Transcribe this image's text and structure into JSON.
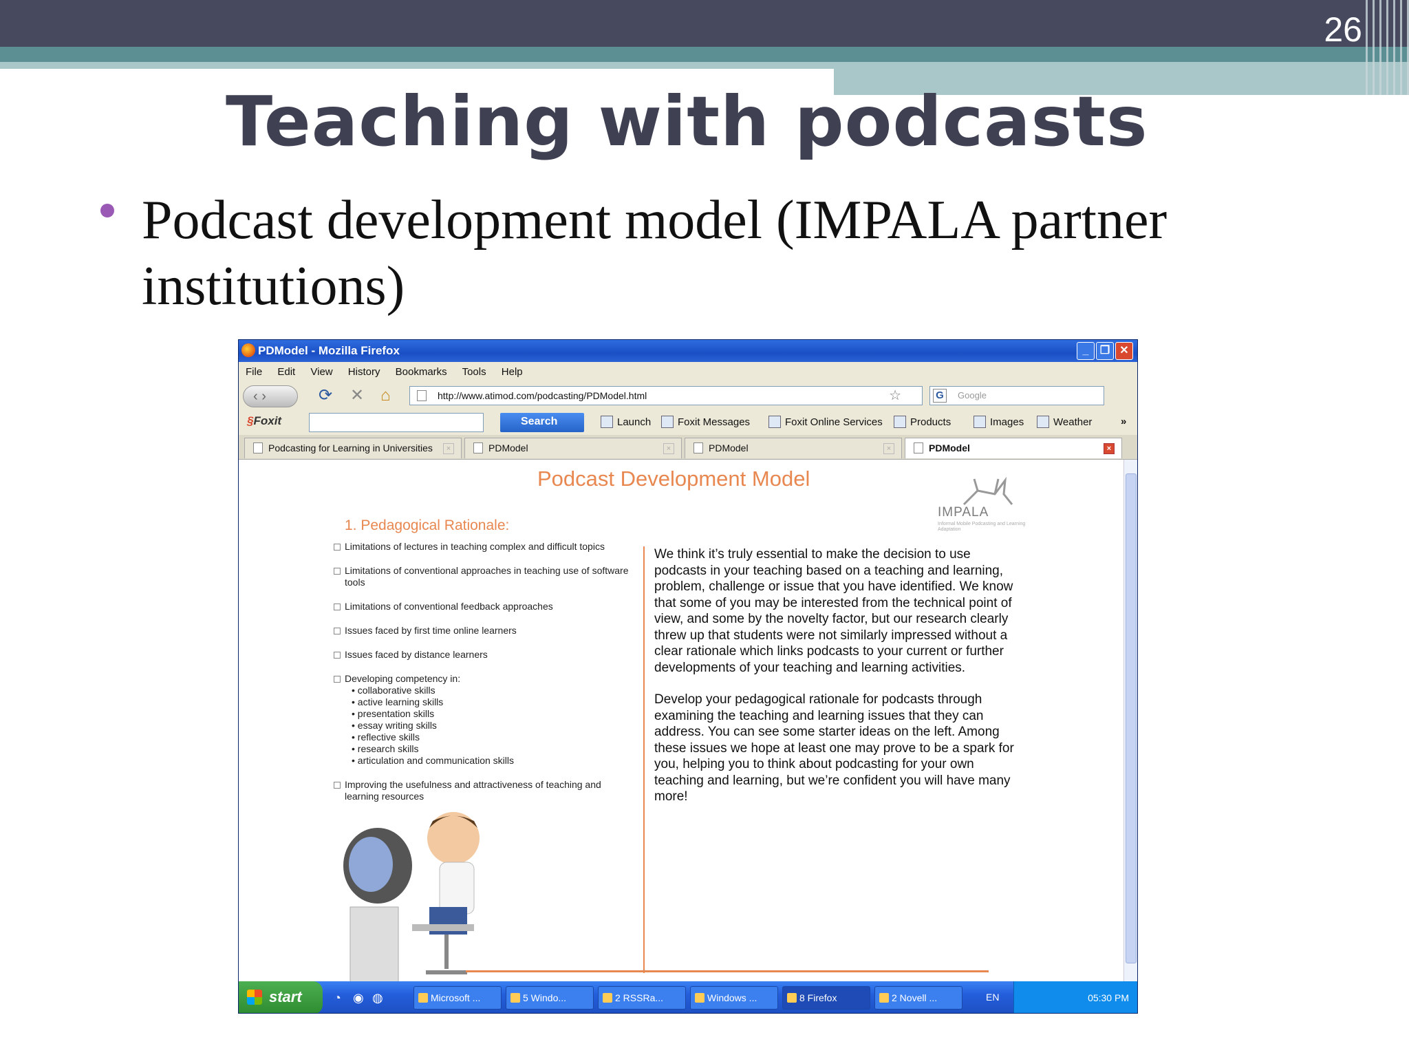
{
  "slide": {
    "number": "26",
    "title": "Teaching with podcasts",
    "bullet": "Podcast development model (IMPALA partner institutions)"
  },
  "browser": {
    "window_title": "PDModel - Mozilla Firefox",
    "menu": [
      "File",
      "Edit",
      "View",
      "History",
      "Bookmarks",
      "Tools",
      "Help"
    ],
    "url": "http://www.atimod.com/podcasting/PDModel.html",
    "search_placeholder": "Google",
    "toolbar": {
      "foxit": "Foxit",
      "search": "Search",
      "launch": "Launch",
      "foxit_messages": "Foxit Messages",
      "foxit_online": "Foxit Online Services",
      "products": "Products",
      "images": "Images",
      "weather": "Weather",
      "more": "»"
    },
    "tabs": [
      {
        "label": "Podcasting for Learning in Universities"
      },
      {
        "label": "PDModel"
      },
      {
        "label": "PDModel"
      },
      {
        "label": "PDModel"
      }
    ]
  },
  "page": {
    "title": "Podcast Development Model",
    "logo_name": "IMPALA",
    "logo_sub": "Informal Mobile Podcasting and Learning Adaptation",
    "heading": "1. Pedagogical Rationale:",
    "items": [
      "Limitations of lectures in teaching complex and difficult topics",
      "Limitations of conventional approaches in teaching use of software tools",
      "Limitations of conventional feedback approaches",
      "Issues faced by first time online learners",
      "Issues faced by distance learners",
      "Developing competency in:",
      "Improving the usefulness and attractiveness of teaching and learning resources"
    ],
    "competencies": [
      "• collaborative skills",
      "• active learning skills",
      "• presentation skills",
      "• essay writing skills",
      "• reflective skills",
      "• research skills",
      "• articulation and communication skills"
    ],
    "paragraph1": "We think it’s truly essential to make the decision to use podcasts in your teaching based on a teaching and learning, problem, challenge or issue that you have identified. We know that some of you may be interested from the technical point of view, and some by the novelty factor, but our research clearly threw up that students were not similarly impressed without a clear rationale which links podcasts to your current or further developments of your teaching and learning activities.",
    "paragraph2": "Develop your pedagogical rationale for podcasts through examining the teaching and learning issues that they can address. You can see some starter ideas on the left. Among these issues we hope at least one may prove to be a spark for you, helping you to think about podcasting for your own teaching and learning, but we’re confident you will have many more!"
  },
  "taskbar": {
    "start": "start",
    "tasks": [
      "Microsoft ...",
      "5 Windo...",
      "2 RSSRa...",
      "Windows ...",
      "8 Firefox",
      "2 Novell ..."
    ],
    "lang": "EN",
    "time": "05:30 PM"
  }
}
